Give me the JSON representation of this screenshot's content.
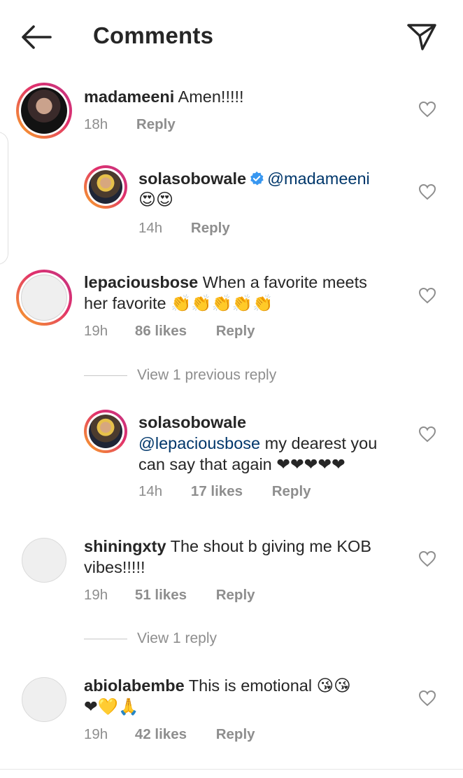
{
  "header": {
    "title": "Comments",
    "back_icon": "arrow-left-icon",
    "share_icon": "paper-plane-icon"
  },
  "colors": {
    "text": "#262626",
    "muted": "#8e8e8e",
    "mention": "#00376b",
    "verified": "#3897f0"
  },
  "comments": [
    {
      "username": "madameeni",
      "text": "Amen!!!!!",
      "time": "18h",
      "likes": "",
      "reply": "Reply"
    },
    {
      "username": "solasobowale",
      "verified": true,
      "mention": "@madameeni",
      "text": "😍😍",
      "time": "14h",
      "likes": "",
      "reply": "Reply"
    },
    {
      "username": "lepaciousbose",
      "text_line1": "When a favorite meets",
      "text_line2": "her favorite 👏👏👏👏👏",
      "time": "19h",
      "likes": "86 likes",
      "reply": "Reply"
    },
    {
      "username": "solasobowale",
      "mention": "@lepaciousbose",
      "text_line1": " my dearest you",
      "text_line2": "can say that again ❤❤❤❤❤",
      "time": "14h",
      "likes": "17 likes",
      "reply": "Reply"
    },
    {
      "username": "shiningxty",
      "text_line1": "The shout b giving me KOB",
      "text_line2": "vibes!!!!!",
      "time": "19h",
      "likes": "51 likes",
      "reply": "Reply"
    },
    {
      "username": "abiolabembe",
      "text_line1": "This is emotional 😘😘",
      "text_line2": "❤💛🙏",
      "time": "19h",
      "likes": "42 likes",
      "reply": "Reply"
    }
  ],
  "view_previous_reply": "View 1 previous reply",
  "view_reply": "View 1 reply"
}
